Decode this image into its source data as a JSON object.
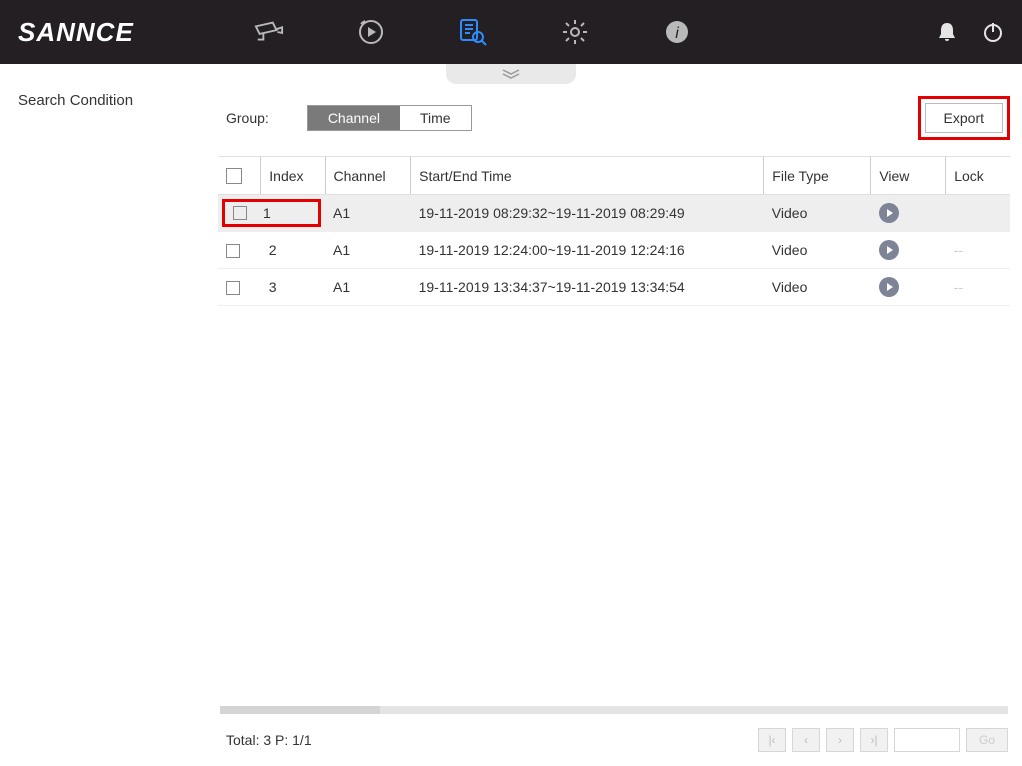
{
  "brand": "SANNCE",
  "sidebar": {
    "title": "Search Condition"
  },
  "controls": {
    "group_label": "Group:",
    "channel": "Channel",
    "time": "Time",
    "export": "Export"
  },
  "table": {
    "headers": {
      "index": "Index",
      "channel": "Channel",
      "start_end": "Start/End Time",
      "file_type": "File Type",
      "view": "View",
      "lock": "Lock"
    },
    "rows": [
      {
        "index": "1",
        "channel": "A1",
        "time": "19-11-2019 08:29:32~19-11-2019 08:29:49",
        "file_type": "Video",
        "lock": "",
        "selected": true
      },
      {
        "index": "2",
        "channel": "A1",
        "time": "19-11-2019 12:24:00~19-11-2019 12:24:16",
        "file_type": "Video",
        "lock": "--",
        "selected": false
      },
      {
        "index": "3",
        "channel": "A1",
        "time": "19-11-2019 13:34:37~19-11-2019 13:34:54",
        "file_type": "Video",
        "lock": "--",
        "selected": false
      }
    ]
  },
  "footer": {
    "total": "Total: 3  P: 1/1",
    "go": "Go"
  }
}
